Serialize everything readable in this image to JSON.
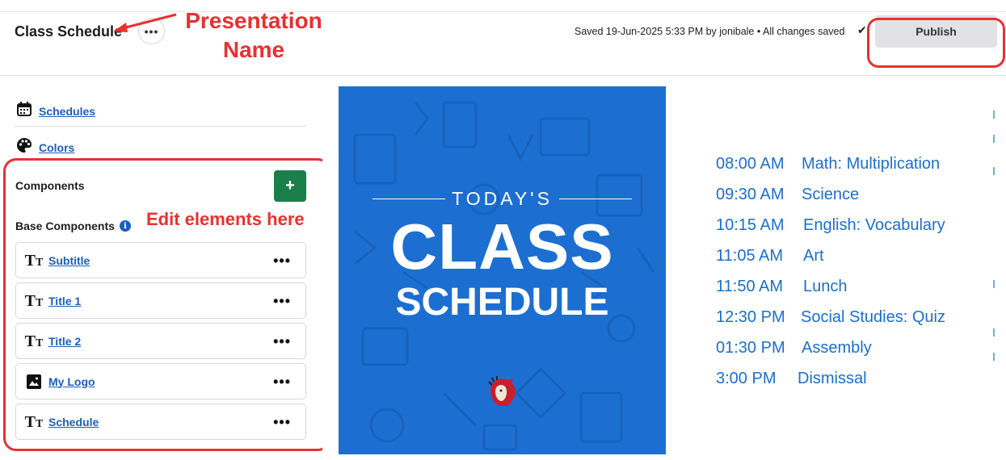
{
  "header": {
    "presentation_title": "Class Schedule",
    "more_label": "•••",
    "saved_status": "Saved 19-Jun-2025 5:33 PM by jonibale • All changes saved",
    "publish_label": "Publish"
  },
  "annotations": {
    "presentation_name": "Presentation Name",
    "edit_elements": "Edit elements here"
  },
  "sidebar": {
    "nav": [
      {
        "label": "Schedules",
        "icon": "calendar-icon"
      },
      {
        "label": "Colors",
        "icon": "palette-icon"
      }
    ],
    "components_title": "Components",
    "add_label": "+",
    "base_components_title": "Base Components",
    "components": [
      {
        "label": "Subtitle",
        "icon": "text-icon"
      },
      {
        "label": "Title 1",
        "icon": "text-icon"
      },
      {
        "label": "Title 2",
        "icon": "text-icon"
      },
      {
        "label": "My Logo",
        "icon": "image-icon"
      },
      {
        "label": "Schedule",
        "icon": "text-icon"
      }
    ],
    "row_menu_label": "•••"
  },
  "slide": {
    "subtitle": "TODAY'S",
    "title1": "CLASS",
    "title2": "SCHEDULE",
    "schedule": [
      {
        "time": "08:00 AM",
        "item": "Math: Multiplication"
      },
      {
        "time": "09:30 AM",
        "item": "Science"
      },
      {
        "time": "10:15 AM",
        "item": "English: Vocabulary"
      },
      {
        "time": "11:05 AM",
        "item": "Art"
      },
      {
        "time": "11:50 AM",
        "item": "Lunch"
      },
      {
        "time": "12:30 PM",
        "item": "Social Studies: Quiz"
      },
      {
        "time": "01:30 PM",
        "item": "Assembly"
      },
      {
        "time": "3:00 PM",
        "item": "Dismissal"
      }
    ]
  },
  "colors": {
    "accent_blue": "#1c6fd1",
    "link_blue": "#1a5fbf",
    "add_green": "#1a7f4b",
    "annotation_red": "#e8312f"
  }
}
